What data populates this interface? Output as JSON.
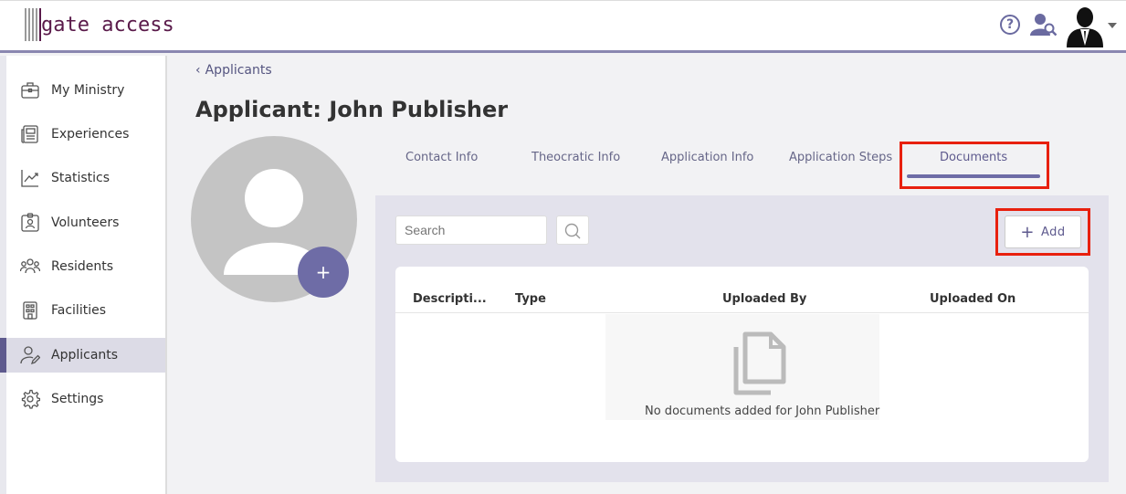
{
  "app": {
    "logo_text": "gate access"
  },
  "header": {
    "help_glyph": "?",
    "icons": [
      "help-icon",
      "user-search-icon",
      "avatar",
      "caret-down-icon"
    ]
  },
  "sidebar": {
    "items": [
      {
        "label": "My Ministry",
        "icon": "briefcase-icon",
        "active": false
      },
      {
        "label": "Experiences",
        "icon": "newspaper-icon",
        "active": false
      },
      {
        "label": "Statistics",
        "icon": "chart-icon",
        "active": false
      },
      {
        "label": "Volunteers",
        "icon": "id-badge-icon",
        "active": false
      },
      {
        "label": "Residents",
        "icon": "people-icon",
        "active": false
      },
      {
        "label": "Facilities",
        "icon": "building-icon",
        "active": false
      },
      {
        "label": "Applicants",
        "icon": "user-edit-icon",
        "active": true
      },
      {
        "label": "Settings",
        "icon": "gear-icon",
        "active": false
      }
    ]
  },
  "breadcrumb": {
    "back_label": "Applicants"
  },
  "page": {
    "title": "Applicant: John Publisher",
    "profile_add_glyph": "+"
  },
  "tabs": [
    {
      "label": "Contact Info",
      "active": false
    },
    {
      "label": "Theocratic Info",
      "active": false
    },
    {
      "label": "Application Info",
      "active": false
    },
    {
      "label": "Application Steps",
      "active": false
    },
    {
      "label": "Documents",
      "active": true
    }
  ],
  "documents": {
    "search_placeholder": "Search",
    "add_label": "Add",
    "columns": [
      "Descripti...",
      "Type",
      "Uploaded By",
      "Uploaded On"
    ],
    "rows": [],
    "empty_message": "No documents added for John Publisher"
  },
  "colors": {
    "accent": "#6e6ca6",
    "highlight": "#e8200e",
    "logo": "#5a1a4a"
  }
}
